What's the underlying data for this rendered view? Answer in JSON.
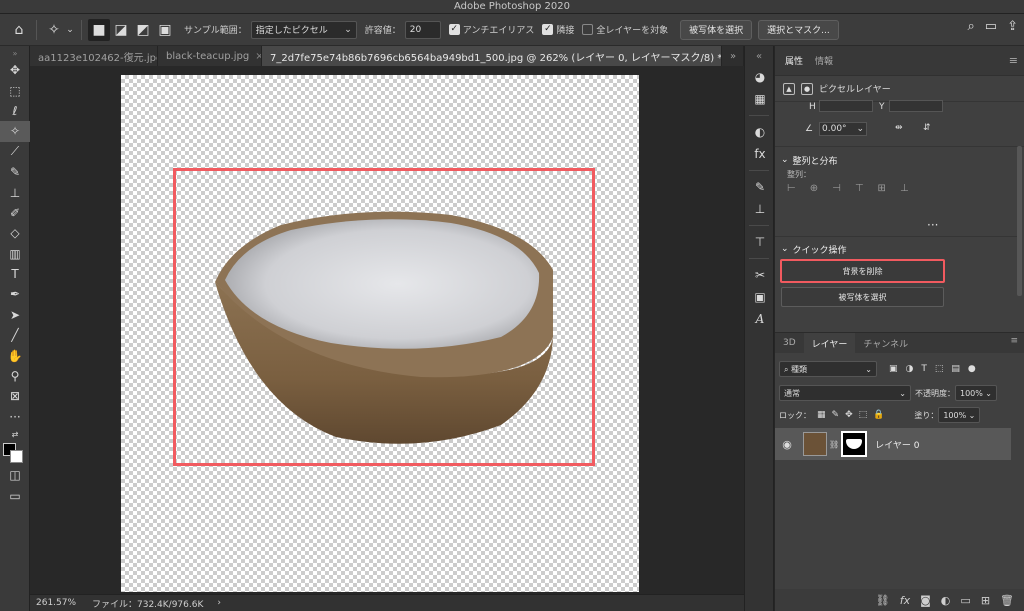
{
  "app": {
    "title": "Adobe Photoshop 2020"
  },
  "options_bar": {
    "sample_label": "サンプル範囲：",
    "sample_value": "指定したピクセル",
    "tolerance_label": "許容値：",
    "tolerance_value": "20",
    "antialias_label": "アンチエイリアス",
    "contiguous_label": "隣接",
    "all_layers_label": "全レイヤーを対象",
    "select_subject_label": "被写体を選択",
    "select_mask_label": "選択とマスク..."
  },
  "tabs": [
    {
      "label": "aa1123e102462-復元.jpg"
    },
    {
      "label": "black-teacup.jpg"
    },
    {
      "label": "7_2d7fe75e74b86b7696cb6564ba949bd1_500.jpg @ 262% (レイヤー 0, レイヤーマスク/8) *"
    }
  ],
  "status": {
    "zoom": "261.57%",
    "file": "ファイル：732.4K/976.6K"
  },
  "properties": {
    "tab_properties": "属性",
    "tab_info": "情報",
    "pixel_layer_label": "ピクセルレイヤー",
    "w_label": "H",
    "y_label": "Y",
    "angle_value": "0.00°",
    "align_section": "整列と分布",
    "align_label": "整列：",
    "quick_section": "クイック操作",
    "remove_bg_label": "背景を削除",
    "select_subject_label": "被写体を選択"
  },
  "layers": {
    "tab_3d": "3D",
    "tab_layers": "レイヤー",
    "tab_channels": "チャンネル",
    "filter_kind": "種類",
    "blend_mode": "通常",
    "opacity_label": "不透明度：",
    "opacity_value": "100%",
    "lock_label": "ロック：",
    "fill_label": "塗り：",
    "fill_value": "100%",
    "layer_name": "レイヤー 0"
  },
  "colors": {
    "highlight_red": "#f15a5f"
  }
}
